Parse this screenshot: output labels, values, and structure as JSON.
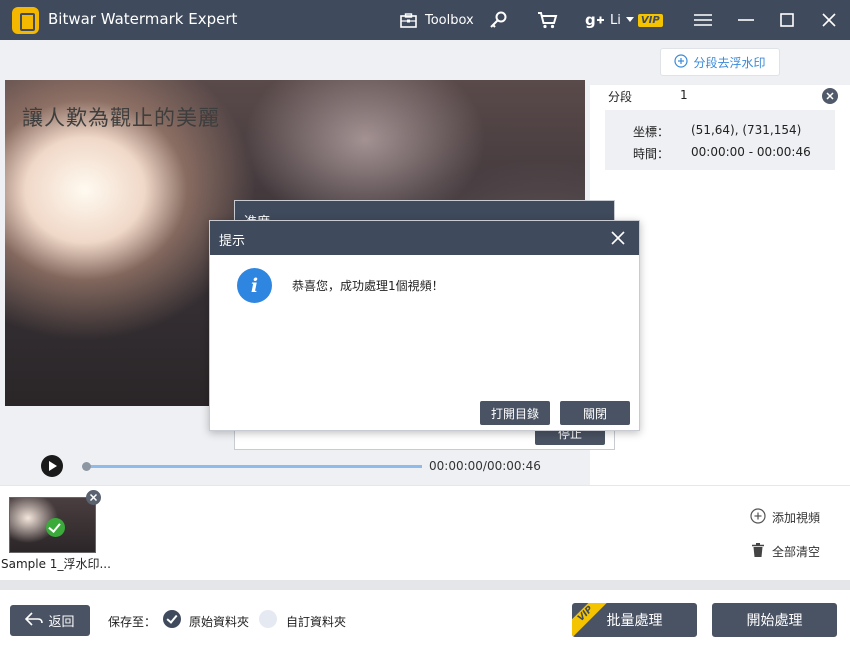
{
  "app": {
    "title": "Bitwar Watermark Expert",
    "toolbox_label": "Toolbox",
    "user_name": "Li",
    "vip_badge": "VIP"
  },
  "right_panel": {
    "segment_button": "分段去浮水印",
    "segment_label": "分段",
    "segment_number": "1",
    "coord_label": "坐標：",
    "coord_value": "(51,64), (731,154)",
    "time_label": "時間：",
    "time_value": "00:00:00 - 00:00:46"
  },
  "video": {
    "overlay_text": "讓人歎為觀止的美麗",
    "time_display": "00:00:00/00:00:46",
    "progress": 0
  },
  "thumbnails": [
    {
      "name": "Sample 1_浮水印..."
    }
  ],
  "side_actions": {
    "add_video": "添加視頻",
    "clear_all": "全部清空"
  },
  "bottom": {
    "back": "返回",
    "save_to": "保存至：",
    "option_original": "原始資料夾",
    "option_custom": "自訂資料夾",
    "batch": "批量處理",
    "start": "開始處理",
    "vip_ribbon": "VIP"
  },
  "progress_dialog": {
    "title": "進度",
    "stop": "停止"
  },
  "message_dialog": {
    "title": "提示",
    "message": "恭喜您，成功處理1個視頻！",
    "open_dir": "打開目錄",
    "close": "關閉"
  },
  "colors": {
    "titlebar": "#3f4a5c",
    "button": "#4a5363",
    "accent_blue": "#2f86e0",
    "vip_yellow": "#f5c400",
    "success_green": "#3aaa3a"
  }
}
